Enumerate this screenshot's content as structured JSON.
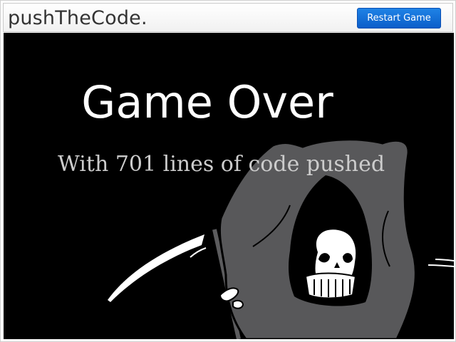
{
  "header": {
    "brand": "pushTheCode.",
    "restart_label": "Restart Game"
  },
  "game_over": {
    "title": "Game Over",
    "summary": "With 701 lines of code pushed"
  },
  "icons": {
    "reaper": "grim-reaper-illustration"
  },
  "colors": {
    "stage_background": "#000000",
    "button_accent": "#0b6cd6",
    "reaper_cloak": "#58585a"
  }
}
